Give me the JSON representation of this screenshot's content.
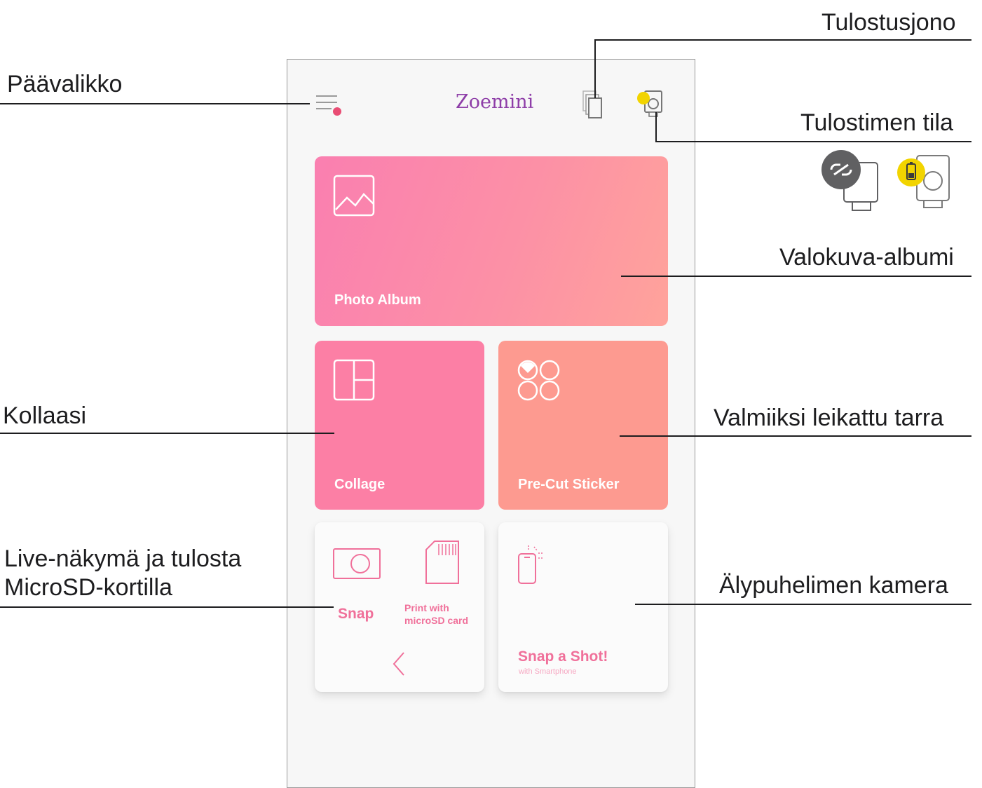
{
  "callouts": {
    "main_menu": "Päävalikko",
    "print_queue": "Tulostusjono",
    "printer_status": "Tulostimen tila",
    "photo_album": "Valokuva-albumi",
    "collage": "Kollaasi",
    "precut_sticker": "Valmiiksi leikattu tarra",
    "live_view_line1": "Live-näkymä ja tulosta",
    "live_view_line2": "MicroSD-kortilla",
    "smartphone_camera": "Älypuhelimen kamera"
  },
  "app": {
    "brand": "Zoemini",
    "tiles": {
      "photo_album": "Photo Album",
      "collage": "Collage",
      "precut_sticker": "Pre-Cut Sticker",
      "snap": "Snap",
      "print_sd_line1": "Print with",
      "print_sd_line2": "microSD card",
      "snap_shot": "Snap a Shot!",
      "snap_shot_sub": "with Smartphone"
    }
  },
  "icons": {
    "menu": "menu-icon",
    "print_queue": "print-queue-icon",
    "printer_status": "printer-status-icon",
    "disconnected_printer": "printer-disconnected-icon",
    "battery_printer": "printer-battery-icon",
    "photo": "image-icon",
    "collage": "collage-grid-icon",
    "sticker": "sticker-shapes-icon",
    "camera": "camera-icon",
    "sd_card": "sd-card-icon",
    "phone": "smartphone-icon",
    "back": "chevron-left-icon"
  },
  "colors": {
    "accent_pink": "#f0709a",
    "brand_purple": "#8e3ea8",
    "notification_dot": "#e94d74",
    "status_yellow": "#f2d400",
    "status_gray": "#606062"
  }
}
